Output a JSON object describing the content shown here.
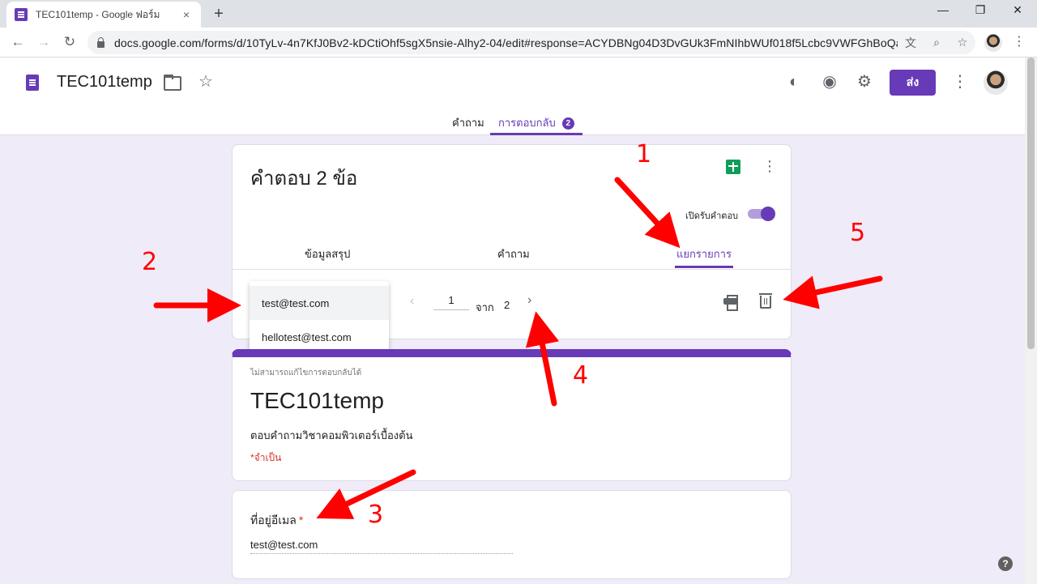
{
  "browser": {
    "tab_title": "TEC101temp - Google ฟอร์ม",
    "tab_close": "×",
    "new_tab": "+",
    "win_min": "—",
    "win_max": "❐",
    "win_close": "✕",
    "back": "←",
    "forward": "→",
    "reload": "↻",
    "url": "docs.google.com/forms/d/10TyLv-4n7KfJ0Bv2-kDCtiOhf5sgX5nsie-Alhy2-04/edit#response=ACYDBNg04D3DvGUk3FmNIhbWUf018f5Lcbc9VWFGhBoQa...",
    "translate_icon": "文",
    "zoom_icon": "⌕",
    "bookmark_icon": "☆",
    "menu": "⋮"
  },
  "header": {
    "title": "TEC101temp",
    "star": "☆",
    "palette": "◐",
    "preview": "◉",
    "settings": "⚙",
    "send_label": "ส่ง",
    "more": "⋮",
    "tabs": [
      {
        "label": "คำถาม"
      },
      {
        "label": "การตอบกลับ",
        "badge": "2"
      }
    ]
  },
  "summary": {
    "title": "คำตอบ 2 ข้อ",
    "more": "⋮",
    "accepting_label": "เปิดรับคำตอบ",
    "accepting": true,
    "sub_tabs": [
      "ข้อมูลสรุป",
      "คำถาม",
      "แยกรายการ"
    ],
    "pager": {
      "prev": "‹",
      "current": "1",
      "of_label": "จาก",
      "total": "2",
      "next": "›"
    },
    "respondents": [
      "test@test.com",
      "hellotest@test.com"
    ]
  },
  "form": {
    "readonly_note": "ไม่สามารถแก้ไขการตอบกลับได้",
    "title": "TEC101temp",
    "description": "ตอบคำถามวิชาคอมพิวเตอร์เบื้องต้น",
    "required_note": "*จำเป็น"
  },
  "question": {
    "label": "ที่อยู่อีเมล",
    "required_mark": "*",
    "answer": "test@test.com"
  },
  "help": "?",
  "annotations": [
    "1",
    "2",
    "3",
    "4",
    "5"
  ],
  "colors": {
    "accent": "#673ab7",
    "background": "#f0ebf8",
    "annotation": "#ff0000",
    "required": "#d93025"
  }
}
